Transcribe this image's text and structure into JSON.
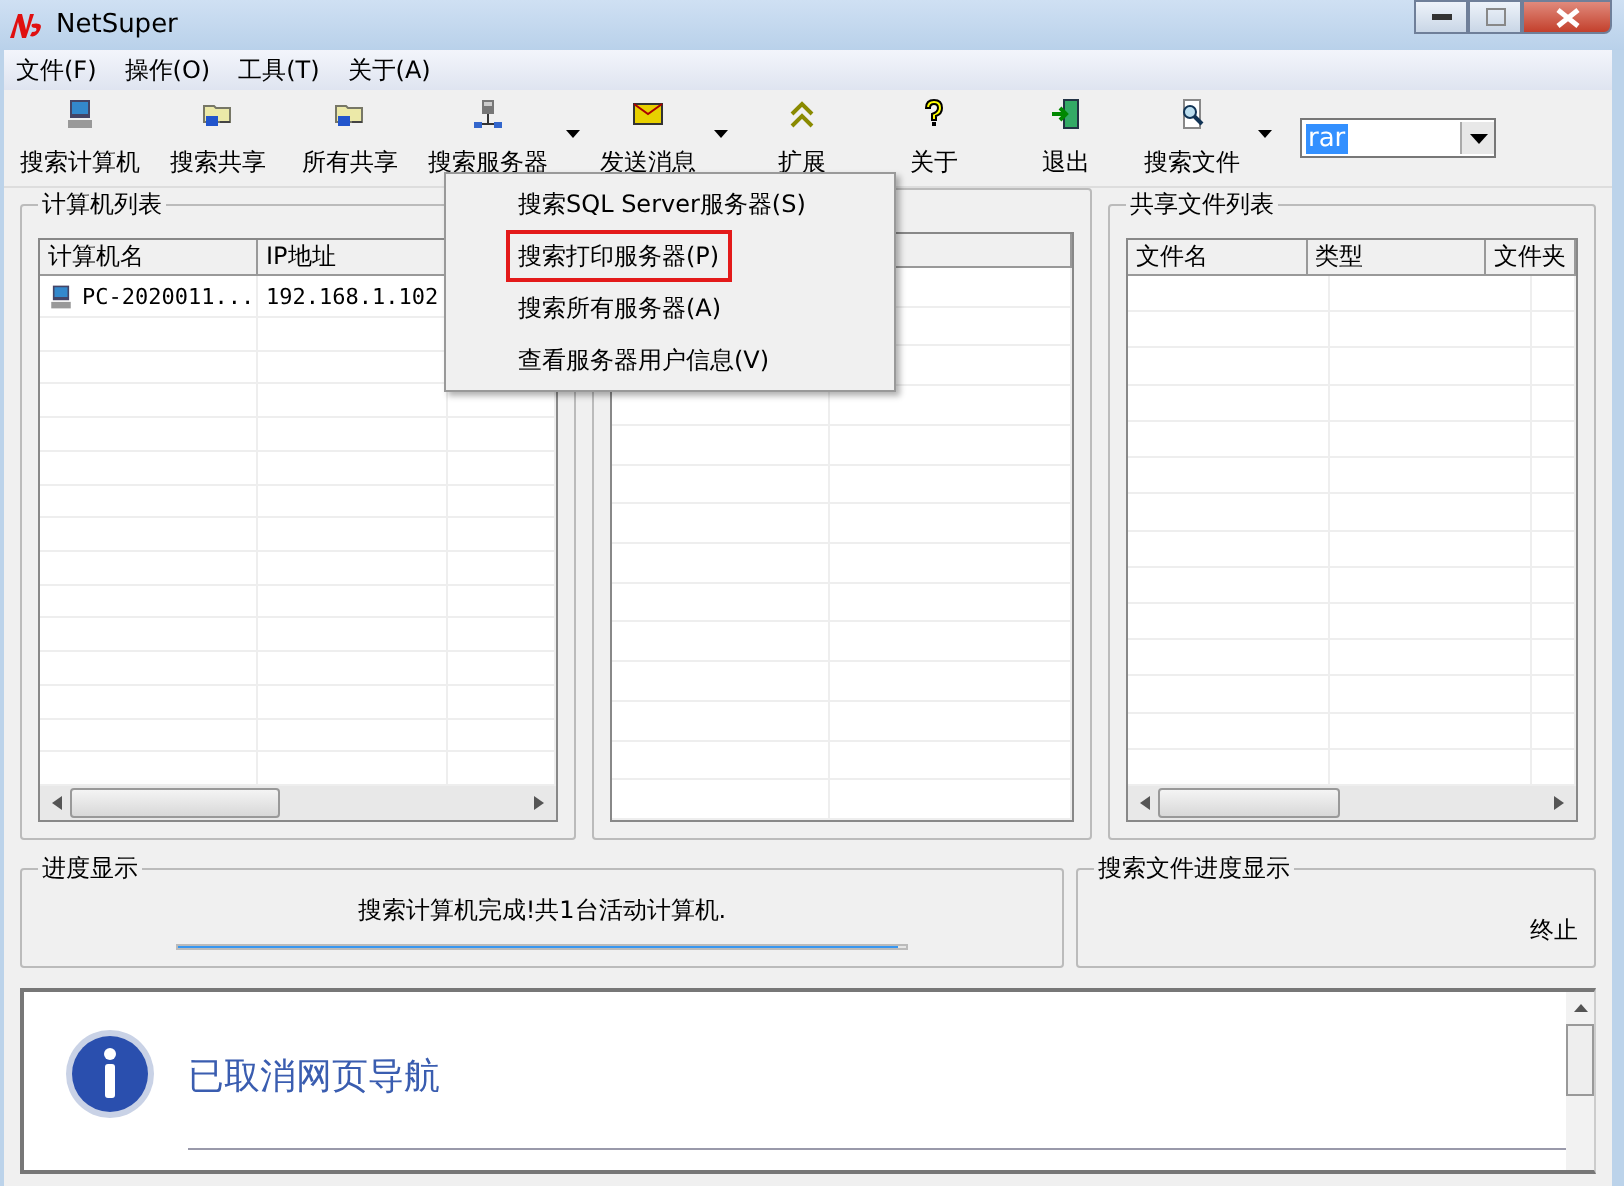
{
  "window": {
    "title": "NetSuper"
  },
  "menu": [
    {
      "label": "文件(F)"
    },
    {
      "label": "操作(O)"
    },
    {
      "label": "工具(T)"
    },
    {
      "label": "关于(A)"
    }
  ],
  "toolbar": [
    {
      "label": "搜索计算机",
      "kind": "computer",
      "dropdown": false
    },
    {
      "label": "搜索共享",
      "kind": "share",
      "dropdown": false
    },
    {
      "label": "所有共享",
      "kind": "share",
      "dropdown": false
    },
    {
      "label": "搜索服务器",
      "kind": "server",
      "dropdown": true
    },
    {
      "label": "发送消息",
      "kind": "message",
      "dropdown": true
    },
    {
      "label": "扩展",
      "kind": "expand",
      "dropdown": false
    },
    {
      "label": "关于",
      "kind": "help",
      "dropdown": false
    },
    {
      "label": "退出",
      "kind": "exit",
      "dropdown": false
    },
    {
      "label": "搜索文件",
      "kind": "findfile",
      "dropdown": true
    }
  ],
  "search_combo": {
    "value": "rar"
  },
  "computer_list": {
    "title": "计算机列表",
    "columns": [
      "计算机名",
      "IP地址"
    ],
    "rows": [
      {
        "name": "PC-2020011...",
        "ip": "192.168.1.102"
      }
    ]
  },
  "share_files": {
    "title": "共享文件列表",
    "columns": [
      "文件名",
      "类型",
      "文件夹"
    ]
  },
  "context_menu": {
    "items": [
      {
        "label": "搜索SQL Server服务器(S)",
        "highlighted": false
      },
      {
        "label": "搜索打印服务器(P)",
        "highlighted": true
      },
      {
        "label": "搜索所有服务器(A)",
        "highlighted": false
      },
      {
        "label": "查看服务器用户信息(V)",
        "highlighted": false
      }
    ]
  },
  "progress": {
    "title": "进度显示",
    "message": "搜索计算机完成!共1台活动计算机.",
    "level": 0.99
  },
  "file_progress": {
    "title": "搜索文件进度显示",
    "stop": "终止"
  },
  "browser_notice": {
    "message": "已取消网页导航"
  }
}
